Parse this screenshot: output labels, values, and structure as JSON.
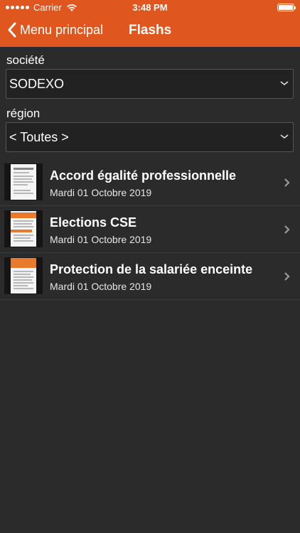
{
  "statusbar": {
    "carrier": "Carrier",
    "time": "3:48 PM"
  },
  "navbar": {
    "back_label": "Menu principal",
    "title": "Flashs"
  },
  "form": {
    "societe_label": "société",
    "societe_value": "SODEXO",
    "region_label": "région",
    "region_value": "< Toutes >"
  },
  "flashs": [
    {
      "title": "Accord égalité professionnelle",
      "date": "Mardi 01 Octobre 2019"
    },
    {
      "title": "Elections CSE",
      "date": "Mardi 01 Octobre 2019"
    },
    {
      "title": "Protection de la salariée enceinte",
      "date": "Mardi 01 Octobre 2019"
    }
  ],
  "colors": {
    "accent": "#e0561f",
    "background": "#2b2b2b"
  }
}
